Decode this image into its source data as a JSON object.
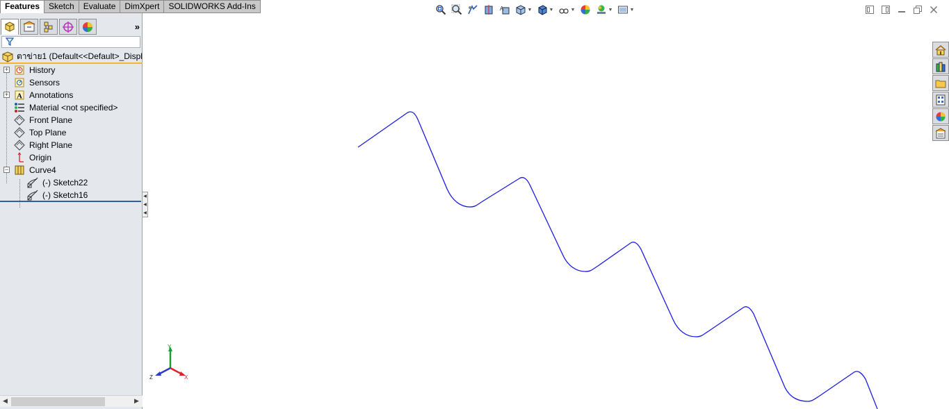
{
  "command_tabs": [
    {
      "label": "Features",
      "active": true
    },
    {
      "label": "Sketch",
      "active": false
    },
    {
      "label": "Evaluate",
      "active": false
    },
    {
      "label": "DimXpert",
      "active": false
    },
    {
      "label": "SOLIDWORKS Add-Ins",
      "active": false
    }
  ],
  "hud_icons": [
    "zoom-to-fit-icon",
    "zoom-to-area-icon",
    "previous-view-icon",
    "section-view-icon",
    "dynamic-annotation-view-icon",
    "view-orientation-icon",
    "display-style-icon",
    "hide-show-items-icon",
    "edit-appearance-icon",
    "apply-scene-icon",
    "view-settings-icon"
  ],
  "panel_tabs": [
    "featuremanager-tree-icon",
    "propertymanager-icon",
    "configurationmanager-icon",
    "dimxpertmanager-icon",
    "displaymanager-icon"
  ],
  "tree": {
    "root_label": "ตาข่าย1  (Default<<Default>_Displa",
    "items": [
      {
        "label": "History",
        "icon": "history-icon",
        "expandable": true
      },
      {
        "label": "Sensors",
        "icon": "sensors-icon",
        "expandable": false
      },
      {
        "label": "Annotations",
        "icon": "annotations-icon",
        "expandable": true
      },
      {
        "label": "Material <not specified>",
        "icon": "material-icon",
        "expandable": false
      },
      {
        "label": "Front Plane",
        "icon": "plane-icon",
        "expandable": false
      },
      {
        "label": "Top Plane",
        "icon": "plane-icon",
        "expandable": false
      },
      {
        "label": "Right Plane",
        "icon": "plane-icon",
        "expandable": false
      },
      {
        "label": "Origin",
        "icon": "origin-icon",
        "expandable": false
      },
      {
        "label": "Curve4",
        "icon": "curve-icon",
        "expandable": true,
        "expanded": true
      }
    ],
    "children": [
      {
        "label": "(-) Sketch22",
        "icon": "sketch-icon"
      },
      {
        "label": "(-) Sketch16",
        "icon": "sketch-icon"
      }
    ]
  },
  "triad": {
    "x_label": "X",
    "y_label": "Y",
    "z_label": "Z",
    "x_color": "#e0202a",
    "y_color": "#1f9a2f",
    "z_color": "#2a3cc8"
  },
  "curve_color": "#1a1adf",
  "task_pane_icons": [
    "solidworks-resources-icon",
    "design-library-icon",
    "file-explorer-icon",
    "view-palette-icon",
    "appearances-scenes-icon",
    "custom-properties-icon"
  ],
  "window_controls": [
    "restore-pane-icon",
    "tile-pane-icon",
    "minimize-icon",
    "restore-icon",
    "close-icon"
  ]
}
